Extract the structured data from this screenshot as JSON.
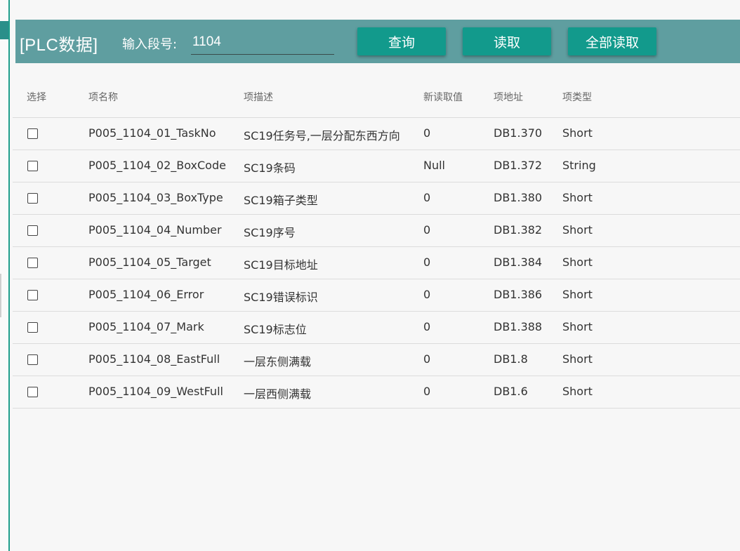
{
  "header": {
    "title": "[PLC数据]",
    "segment_label": "输入段号:",
    "segment_value": "1104",
    "buttons": {
      "query": "查询",
      "read": "读取",
      "read_all": "全部读取"
    }
  },
  "table": {
    "columns": {
      "select": "选择",
      "name": "项名称",
      "desc": "项描述",
      "value": "新读取值",
      "address": "项地址",
      "type": "项类型"
    },
    "rows": [
      {
        "name": "P005_1104_01_TaskNo",
        "desc": "SC19任务号,一层分配东西方向",
        "value": "0",
        "address": "DB1.370",
        "type": "Short"
      },
      {
        "name": "P005_1104_02_BoxCode",
        "desc": "SC19条码",
        "value": "Null",
        "address": "DB1.372",
        "type": "String"
      },
      {
        "name": "P005_1104_03_BoxType",
        "desc": "SC19箱子类型",
        "value": "0",
        "address": "DB1.380",
        "type": "Short"
      },
      {
        "name": "P005_1104_04_Number",
        "desc": "SC19序号",
        "value": "0",
        "address": "DB1.382",
        "type": "Short"
      },
      {
        "name": "P005_1104_05_Target",
        "desc": "SC19目标地址",
        "value": "0",
        "address": "DB1.384",
        "type": "Short"
      },
      {
        "name": "P005_1104_06_Error",
        "desc": "SC19错误标识",
        "value": "0",
        "address": "DB1.386",
        "type": "Short"
      },
      {
        "name": "P005_1104_07_Mark",
        "desc": "SC19标志位",
        "value": "0",
        "address": "DB1.388",
        "type": "Short"
      },
      {
        "name": "P005_1104_08_EastFull",
        "desc": "一层东侧满载",
        "value": "0",
        "address": "DB1.8",
        "type": "Short"
      },
      {
        "name": "P005_1104_09_WestFull",
        "desc": "一层西侧满载",
        "value": "0",
        "address": "DB1.6",
        "type": "Short"
      }
    ]
  },
  "colors": {
    "header_bg": "#5f9ea0",
    "button_bg": "#129a8c",
    "accent": "#1f9e8c"
  }
}
